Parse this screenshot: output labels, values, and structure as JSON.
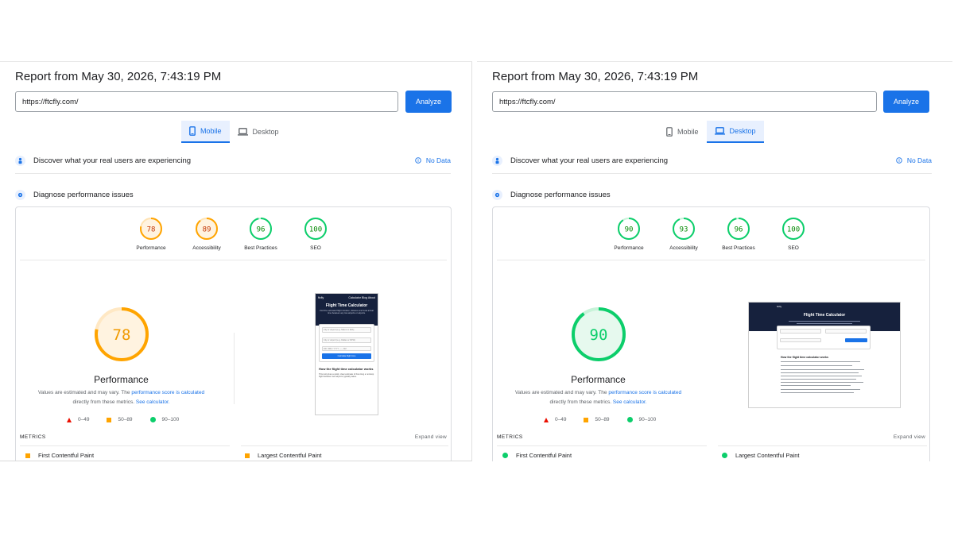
{
  "panels": [
    {
      "report_title": "Report from May 30, 2026, 7:43:19 PM",
      "url": "https://ftcfly.com/",
      "analyze_label": "Analyze",
      "tabs": [
        "Mobile",
        "Desktop"
      ],
      "active_tab": "Mobile",
      "discover_text": "Discover what your real users are experiencing",
      "no_data_label": "No Data",
      "diagnose_text": "Diagnose performance issues",
      "scores": [
        {
          "label": "Performance",
          "value": "78",
          "color": "#ffa400"
        },
        {
          "label": "Accessibility",
          "value": "89",
          "color": "#ffa400"
        },
        {
          "label": "Best Practices",
          "value": "96",
          "color": "#0cce6b"
        },
        {
          "label": "SEO",
          "value": "100",
          "color": "#0cce6b"
        }
      ],
      "big_score": "78",
      "big_label": "Performance",
      "estimate_prefix": "Values are estimated and may vary. The",
      "estimate_link": "performance score is calculated",
      "estimate_mid": "directly from these metrics.",
      "estimate_link2": "See calculator.",
      "legend": [
        "0–49",
        "50–89",
        "90–100"
      ],
      "metrics_label": "METRICS",
      "expand_label": "Expand view",
      "metrics": [
        {
          "label": "First Contentful Paint",
          "status": "average"
        },
        {
          "label": "Largest Contentful Paint",
          "status": "average"
        }
      ],
      "screenshot": {
        "brand": "ftcfly",
        "nav": "Calculator  Blog  About",
        "title": "Flight Time Calculator",
        "subtitle": "Find the estimated flight duration, distance and local arrival time between any two airports or airports.",
        "from_placeholder": "City or airport (e.g. Miami or MIA)",
        "to_placeholder": "City or airport (e.g. Dallas or DFW)",
        "date_placeholder": "DD / MM / YYYY  --:-- AM",
        "button": "Calculate flight time",
        "section_title": "How the flight time calculator works",
        "section_text": "This tool gives a quick, clear estimate of how long a nonstop flight between two airports typically takes."
      }
    },
    {
      "report_title": "Report from May 30, 2026, 7:43:19 PM",
      "url": "https://ftcfly.com/",
      "analyze_label": "Analyze",
      "tabs": [
        "Mobile",
        "Desktop"
      ],
      "active_tab": "Desktop",
      "discover_text": "Discover what your real users are experiencing",
      "no_data_label": "No Data",
      "diagnose_text": "Diagnose performance issues",
      "scores": [
        {
          "label": "Performance",
          "value": "90",
          "color": "#0cce6b"
        },
        {
          "label": "Accessibility",
          "value": "93",
          "color": "#0cce6b"
        },
        {
          "label": "Best Practices",
          "value": "96",
          "color": "#0cce6b"
        },
        {
          "label": "SEO",
          "value": "100",
          "color": "#0cce6b"
        }
      ],
      "big_score": "90",
      "big_label": "Performance",
      "estimate_prefix": "Values are estimated and may vary. The",
      "estimate_link": "performance score is calculated",
      "estimate_mid": "directly from these metrics.",
      "estimate_link2": "See calculator.",
      "legend": [
        "0–49",
        "50–89",
        "90–100"
      ],
      "metrics_label": "METRICS",
      "expand_label": "Expand view",
      "metrics": [
        {
          "label": "First Contentful Paint",
          "status": "good"
        },
        {
          "label": "Largest Contentful Paint",
          "status": "good"
        }
      ],
      "screenshot": {
        "brand": "ftcfly",
        "title": "Flight Time Calculator",
        "section_title": "How the flight time calculator works"
      }
    }
  ]
}
